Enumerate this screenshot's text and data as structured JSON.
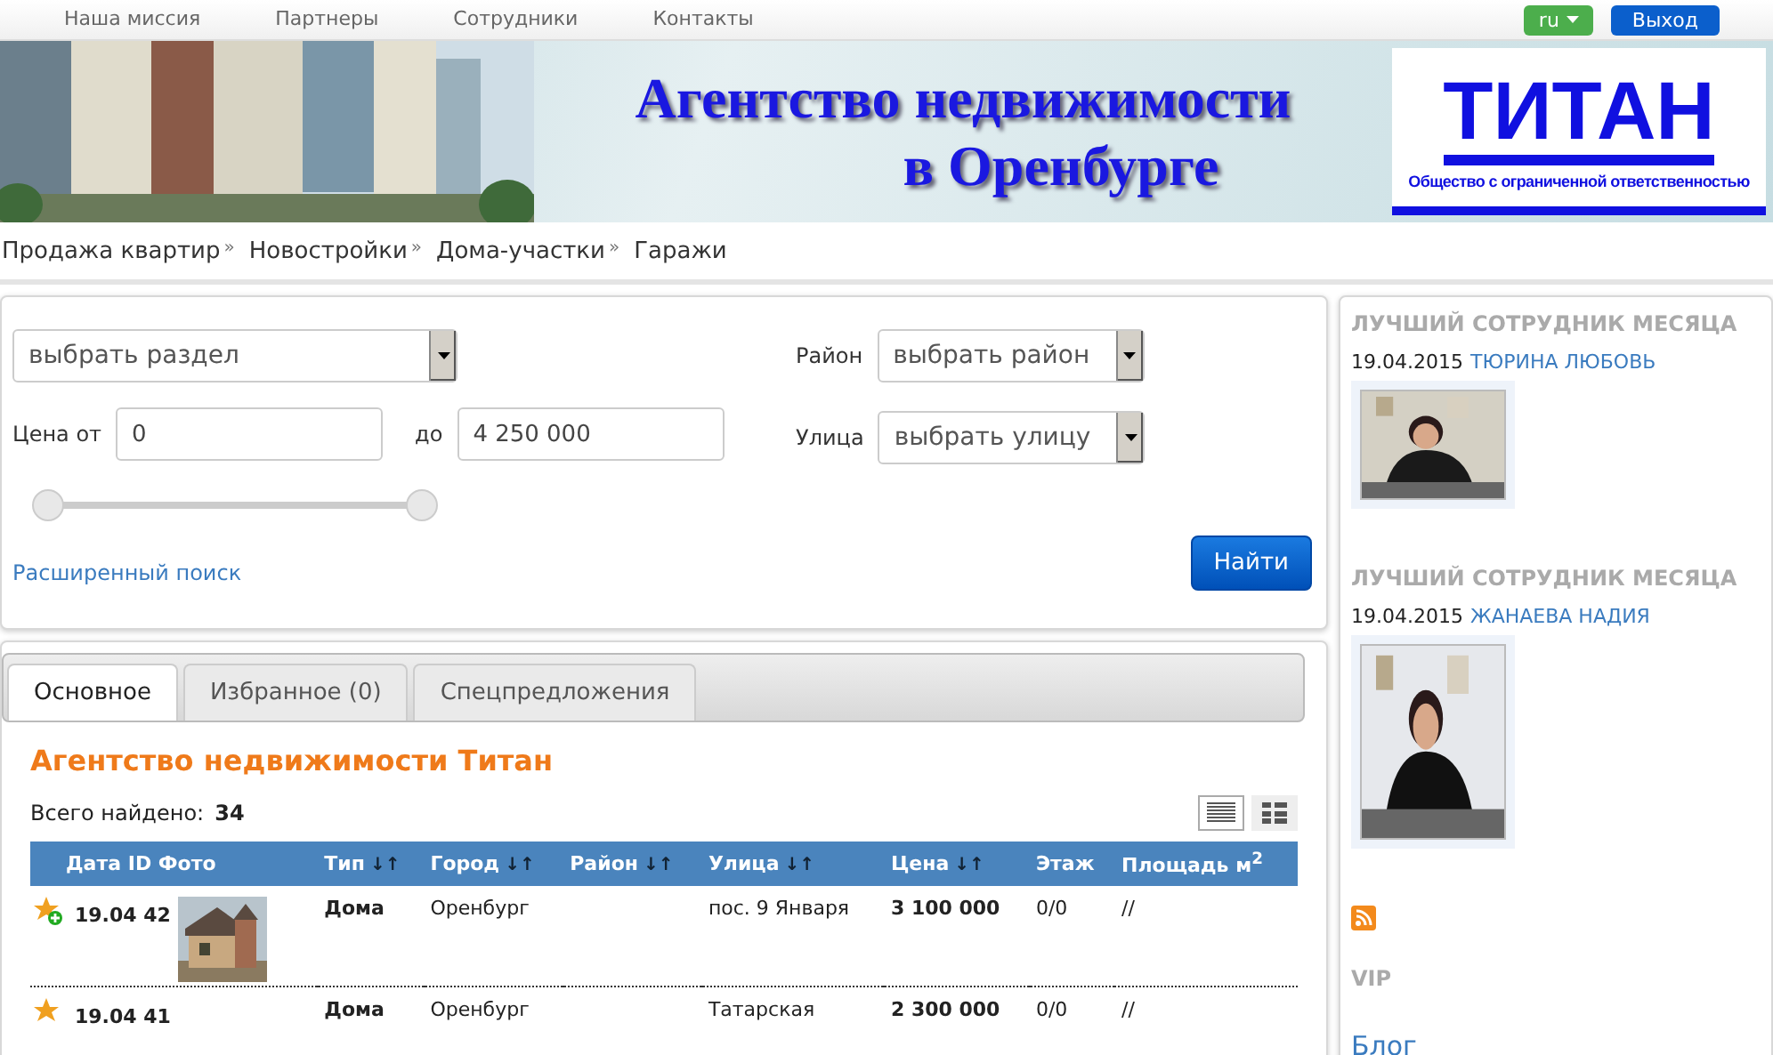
{
  "top_nav": {
    "links": [
      "Наша миссия",
      "Партнеры",
      "Сотрудники",
      "Контакты"
    ],
    "language": "ru",
    "logout": "Выход"
  },
  "banner": {
    "title_line1": "Агентство недвижимости",
    "title_line2": "в Оренбурге",
    "logo": "ТИТАН",
    "logo_subtitle": "Общество с ограниченной ответственностью"
  },
  "categories": [
    {
      "label": "Продажа квартир",
      "arrow": "»"
    },
    {
      "label": "Новостройки",
      "arrow": "»"
    },
    {
      "label": "Дома-участки",
      "arrow": "»"
    },
    {
      "label": "Гаражи"
    }
  ],
  "search": {
    "section_select": "выбрать раздел",
    "price_from_label": "Цена от",
    "price_from": "0",
    "price_to_label": "до",
    "price_to": "4 250 000",
    "district_label": "Район",
    "district_select": "выбрать район",
    "street_label": "Улица",
    "street_select": "выбрать улицу",
    "range_low": {
      "level": 0
    },
    "range_high": {
      "level": 1
    },
    "advanced_link": "Расширенный поиск",
    "submit": "Найти"
  },
  "tabs": [
    {
      "label": "Основное",
      "selected": true
    },
    {
      "label": "Избранное (0)",
      "selected": false
    },
    {
      "label": "Спецпредложения",
      "selected": false
    }
  ],
  "listing": {
    "title": "Агентство недвижимости Титан",
    "found_label": "Всего найдено:",
    "found_count": "34",
    "views": [
      {
        "kind": "list",
        "selected": true
      },
      {
        "kind": "grid",
        "selected": false
      }
    ],
    "columns": [
      {
        "label": "Дата ID Фото"
      },
      {
        "label": "Тип",
        "sort": "↓↑"
      },
      {
        "label": "Город",
        "sort": "↓↑"
      },
      {
        "label": "Район",
        "sort": "↓↑"
      },
      {
        "label": "Улица",
        "sort": "↓↑"
      },
      {
        "label": "Цена",
        "sort": "↓↑"
      },
      {
        "label": "Этаж"
      },
      {
        "label": "Площадь м$^{2}$"
      }
    ],
    "rows": [
      {
        "new": true,
        "date": "19.04",
        "id": "42",
        "type": "Дома",
        "city": "Оренбург",
        "street": "пос. 9 Января",
        "price": "3 100 000",
        "floor": "0/0",
        "area": "//"
      },
      {
        "new": false,
        "date": "19.04",
        "id": "41",
        "type": "Дома",
        "city": "Оренбург",
        "street": "Татарская",
        "price": "2 300 000",
        "floor": "0/0",
        "area": "//"
      }
    ]
  },
  "sidebar": {
    "employees": [
      {
        "heading": "ЛУЧШИЙ СОТРУДНИК МЕСЯЦА",
        "date": "19.04.2015",
        "name": "ТЮРИНА ЛЮБОВЬ"
      },
      {
        "heading": "ЛУЧШИЙ СОТРУДНИК МЕСЯЦА",
        "date": "19.04.2015",
        "name": "ЖАНАЕВА НАДИЯ"
      }
    ],
    "vip": "VIP",
    "blog": "Блог"
  }
}
